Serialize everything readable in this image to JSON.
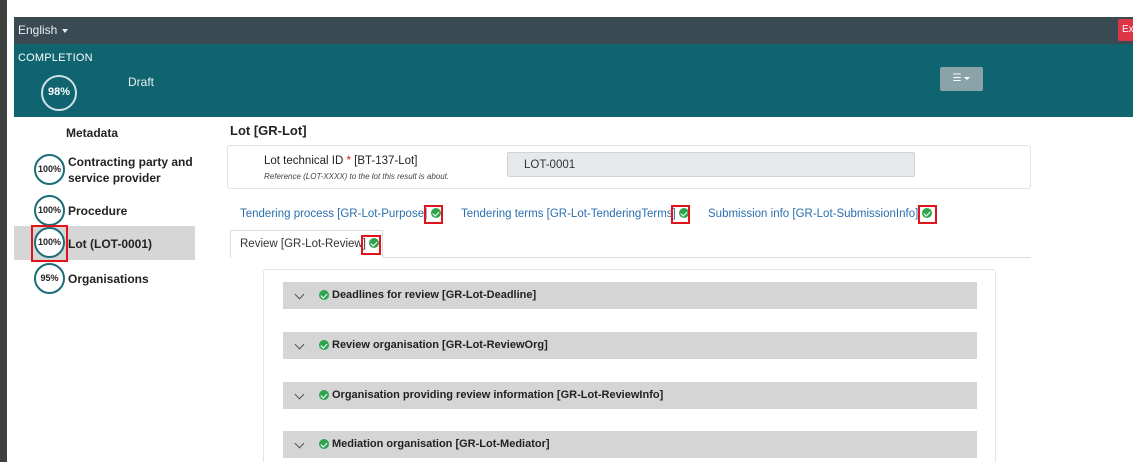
{
  "topbar": {
    "language": "English",
    "exit_label": "Exit"
  },
  "completion": {
    "title": "COMPLETION",
    "percent": "98%",
    "status": "Draft"
  },
  "sidebar": {
    "heading": "Metadata",
    "items": [
      {
        "percent": "100%",
        "label": "Contracting party and service provider"
      },
      {
        "percent": "100%",
        "label": "Procedure"
      },
      {
        "percent": "100%",
        "label": "Lot (LOT-0001)"
      },
      {
        "percent": "95%",
        "label": "Organisations"
      }
    ]
  },
  "main": {
    "title": "Lot [GR-Lot]",
    "field": {
      "label": "Lot technical ID",
      "required_mark": "*",
      "code": "[BT-137-Lot]",
      "hint": "Reference (LOT-XXXX) to the lot this result is about.",
      "value": "LOT-0001"
    },
    "tabs": [
      {
        "label": "Tendering process  [GR-Lot-Purpose]"
      },
      {
        "label": "Tendering terms  [GR-Lot-TenderingTerms]"
      },
      {
        "label": "Submission info  [GR-Lot-SubmissionInfo]"
      },
      {
        "label": "Review  [GR-Lot-Review]"
      }
    ],
    "sections": [
      {
        "label": "Deadlines for review  [GR-Lot-Deadline]"
      },
      {
        "label": "Review organisation  [GR-Lot-ReviewOrg]"
      },
      {
        "label": "Organisation providing review information  [GR-Lot-ReviewInfo]"
      },
      {
        "label": "Mediation organisation  [GR-Lot-Mediator]"
      }
    ]
  },
  "colors": {
    "topbar": "#3a4a52",
    "completion_bar": "#0f6470",
    "highlight": "#e0151b",
    "check": "#2ea44f",
    "link": "#2a6fb0"
  },
  "icons": [
    "caret-down-icon",
    "settings-sliders-icon",
    "check-circle-icon",
    "chevron-down-icon"
  ]
}
